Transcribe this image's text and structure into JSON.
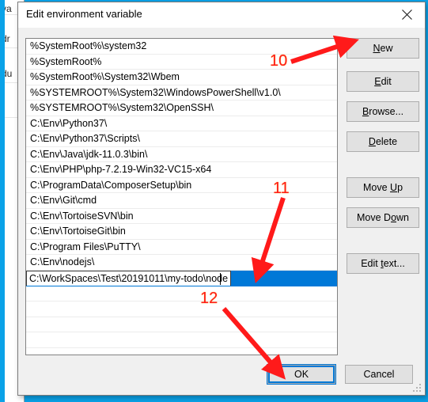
{
  "window": {
    "title": "Edit environment variable",
    "close_icon": "close-icon"
  },
  "background_window": {
    "fragments": [
      "va",
      "dr",
      "du"
    ]
  },
  "path_list": {
    "entries": [
      "%SystemRoot%\\system32",
      "%SystemRoot%",
      "%SystemRoot%\\System32\\Wbem",
      "%SYSTEMROOT%\\System32\\WindowsPowerShell\\v1.0\\",
      "%SYSTEMROOT%\\System32\\OpenSSH\\",
      "C:\\Env\\Python37\\",
      "C:\\Env\\Python37\\Scripts\\",
      "C:\\Env\\Java\\jdk-11.0.3\\bin\\",
      "C:\\Env\\PHP\\php-7.2.19-Win32-VC15-x64",
      "C:\\ProgramData\\ComposerSetup\\bin",
      "C:\\Env\\Git\\cmd",
      "C:\\Env\\TortoiseSVN\\bin",
      "C:\\Env\\TortoiseGit\\bin",
      "C:\\Program Files\\PuTTY\\",
      "C:\\Env\\nodejs\\"
    ],
    "editing_row": {
      "value": "C:\\WorkSpaces\\Test\\20191011\\my-todo\\node",
      "selected": true
    },
    "empty_rows": 5,
    "selection_color": "#0078d7"
  },
  "side_buttons": [
    {
      "id": "new",
      "label": "New",
      "accel": "N"
    },
    {
      "id": "edit",
      "label": "Edit",
      "accel": "E"
    },
    {
      "id": "browse",
      "label": "Browse...",
      "accel": "B"
    },
    {
      "id": "delete",
      "label": "Delete",
      "accel": "D"
    },
    {
      "id": "move-up",
      "label": "Move Up",
      "accel": "U"
    },
    {
      "id": "move-down",
      "label": "Move Down",
      "accel": "D"
    },
    {
      "id": "edit-text",
      "label": "Edit text...",
      "accel": "t"
    }
  ],
  "footer": {
    "ok_label": "OK",
    "cancel_label": "Cancel",
    "focus_color": "#0078d7"
  },
  "annotations": [
    {
      "id": "10",
      "label": "10",
      "points_to": "new-button"
    },
    {
      "id": "11",
      "label": "11",
      "points_to": "editing-row"
    },
    {
      "id": "12",
      "label": "12",
      "points_to": "ok-button"
    }
  ],
  "colors": {
    "desktop": "#0aa2e8",
    "dialog_bg": "#f0f0f0",
    "button_bg": "#e1e1e1",
    "annotation": "#ff1a1a"
  }
}
